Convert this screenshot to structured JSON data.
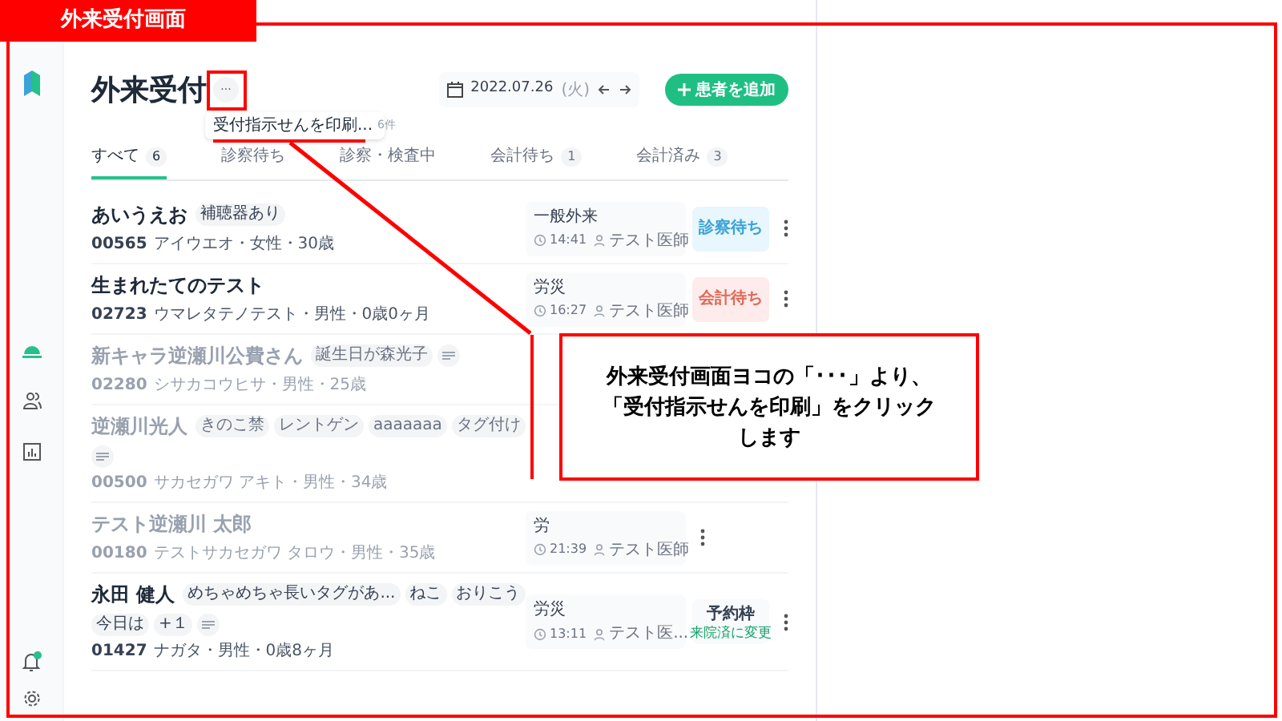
{
  "annotation": {
    "label": "外来受付画面",
    "callout": [
      "外来受付画面ヨコの「･･･」より、",
      "「受付指示せんを印刷」をクリック",
      "します"
    ]
  },
  "page": {
    "title": "外来受付",
    "more_button": "···"
  },
  "menu": {
    "item": "受付指示せんを印刷...",
    "count": "6件"
  },
  "date": {
    "value": "2022.07.26",
    "weekday": "(火)"
  },
  "add_button": "患者を追加",
  "tabs": [
    {
      "label": "すべて",
      "count": "6",
      "selected": true
    },
    {
      "label": "診察待ち",
      "selected": false
    },
    {
      "label": "診察・検査中",
      "selected": false
    },
    {
      "label": "会計待ち",
      "count": "1",
      "selected": false
    },
    {
      "label": "会計済み",
      "count": "3",
      "selected": false
    }
  ],
  "rows": [
    {
      "name": "あいうえお",
      "tags": [
        "補聴器あり"
      ],
      "note": false,
      "id": "00565",
      "meta": "アイウエオ・女性・30歳",
      "muted": false,
      "visit": {
        "type": "一般外来",
        "time": "14:41",
        "doctor": "テスト医師"
      },
      "status": {
        "kind": "exam",
        "label": "診察待ち"
      }
    },
    {
      "name": "生まれたてのテスト",
      "tags": [],
      "note": false,
      "id": "02723",
      "meta": "ウマレタテノテスト・男性・0歳0ヶ月",
      "muted": false,
      "visit": {
        "type": "労災",
        "time": "16:27",
        "doctor": "テスト医師"
      },
      "status": {
        "kind": "billing",
        "label": "会計待ち"
      }
    },
    {
      "name": "新キャラ逆瀬川公費さん",
      "tags": [
        "誕生日が森光子"
      ],
      "note": true,
      "id": "02280",
      "meta": "シサカコウヒサ・男性・25歳",
      "muted": true
    },
    {
      "name": "逆瀬川光人",
      "tags": [
        "きのこ禁",
        "レントゲン",
        "aaaaaaa",
        "タグ付け"
      ],
      "note": true,
      "id": "00500",
      "meta": "サカセガワ アキト・男性・34歳",
      "muted": true
    },
    {
      "name": "テスト逆瀬川 太郎",
      "tags": [],
      "note": false,
      "id": "00180",
      "meta": "テストサカセガワ タロウ・男性・35歳",
      "muted": true,
      "visit": {
        "type": "労",
        "time": "21:39",
        "doctor": "テスト医師"
      }
    },
    {
      "name": "永田 健人",
      "tags": [
        "めちゃめちゃ長いタグがあ...",
        "ねこ",
        "おりこう",
        "今日は",
        "+１"
      ],
      "note": true,
      "id": "01427",
      "meta": "ナガタ・男性・0歳8ヶ月",
      "muted": false,
      "visit": {
        "type": "労災",
        "time": "13:11",
        "doctor": "テスト医..."
      },
      "status": {
        "kind": "reservation",
        "label": "予約枠",
        "sub": "来院済に変更"
      }
    }
  ]
}
